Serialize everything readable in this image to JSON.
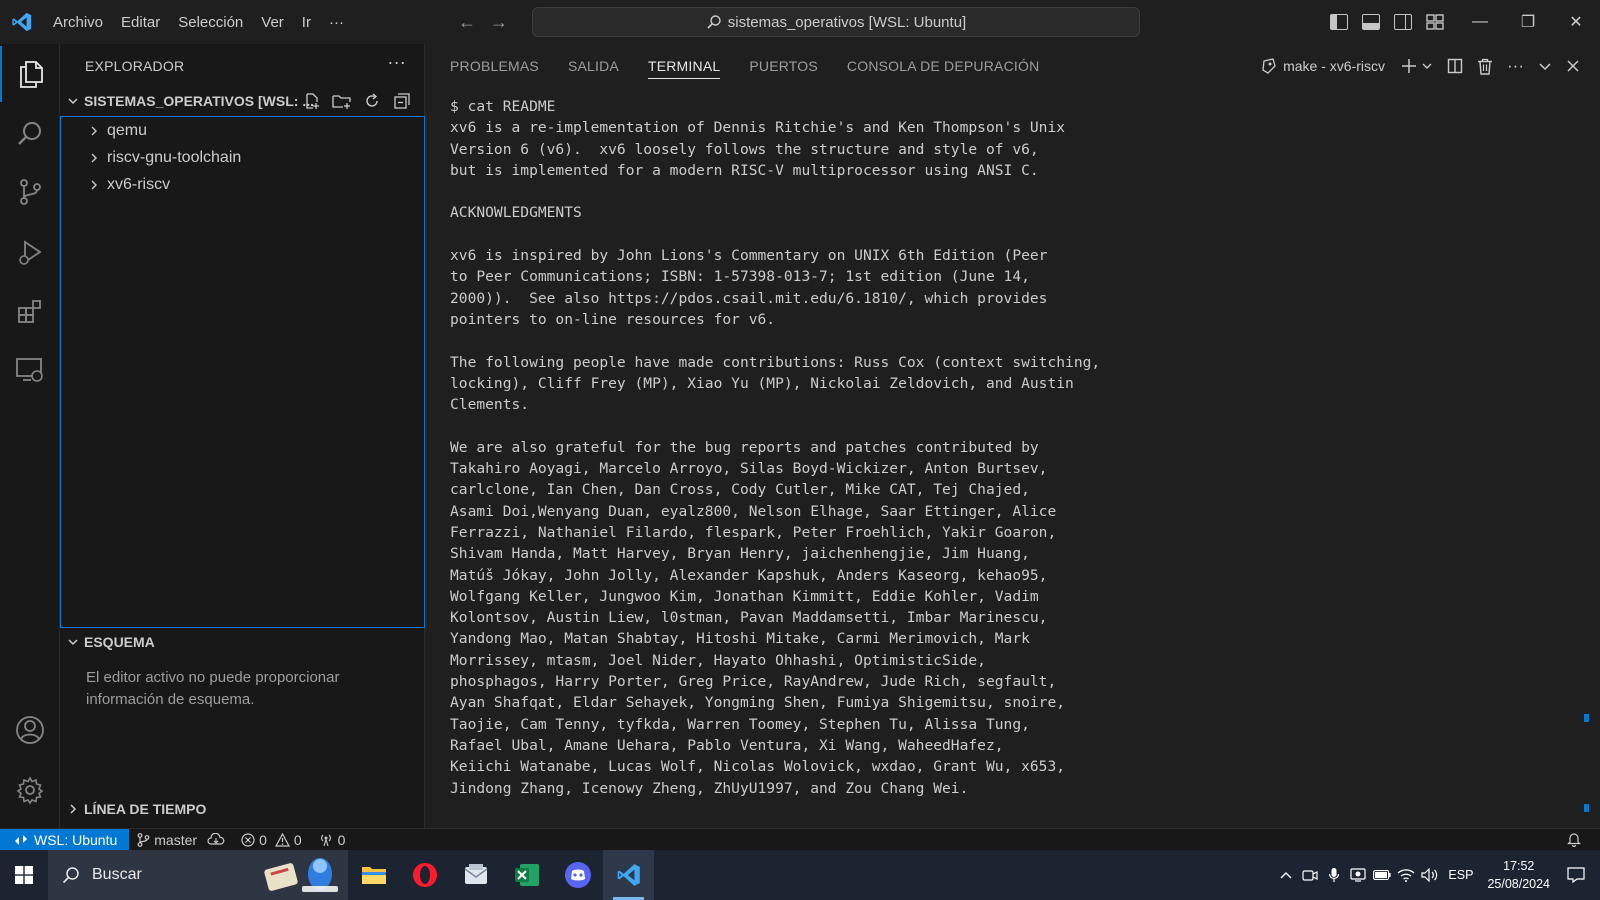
{
  "titlebar": {
    "menu": [
      "Archivo",
      "Editar",
      "Selección",
      "Ver",
      "Ir",
      "···"
    ],
    "command_center": "sistemas_operativos [WSL: Ubuntu]"
  },
  "sidebar": {
    "title": "EXPLORADOR",
    "more": "···",
    "workspace": "SISTEMAS_OPERATIVOS [WSL: ...",
    "tree": [
      {
        "label": "qemu"
      },
      {
        "label": "riscv-gnu-toolchain"
      },
      {
        "label": "xv6-riscv"
      }
    ],
    "outline": {
      "title": "ESQUEMA",
      "message": "El editor activo no puede proporcionar información de esquema."
    },
    "timeline": {
      "title": "LÍNEA DE TIEMPO"
    }
  },
  "panel": {
    "tabs": [
      "PROBLEMAS",
      "SALIDA",
      "TERMINAL",
      "PUERTOS",
      "CONSOLA DE DEPURACIÓN"
    ],
    "active_tab": "TERMINAL",
    "terminal_name": "make - xv6-riscv",
    "terminal_lines": [
      "$ cat README",
      "xv6 is a re-implementation of Dennis Ritchie's and Ken Thompson's Unix",
      "Version 6 (v6).  xv6 loosely follows the structure and style of v6,",
      "but is implemented for a modern RISC-V multiprocessor using ANSI C.",
      "",
      "ACKNOWLEDGMENTS",
      "",
      "xv6 is inspired by John Lions's Commentary on UNIX 6th Edition (Peer",
      "to Peer Communications; ISBN: 1-57398-013-7; 1st edition (June 14,",
      "2000)).  See also https://pdos.csail.mit.edu/6.1810/, which provides",
      "pointers to on-line resources for v6.",
      "",
      "The following people have made contributions: Russ Cox (context switching,",
      "locking), Cliff Frey (MP), Xiao Yu (MP), Nickolai Zeldovich, and Austin",
      "Clements.",
      "",
      "We are also grateful for the bug reports and patches contributed by",
      "Takahiro Aoyagi, Marcelo Arroyo, Silas Boyd-Wickizer, Anton Burtsev,",
      "carlclone, Ian Chen, Dan Cross, Cody Cutler, Mike CAT, Tej Chajed,",
      "Asami Doi,Wenyang Duan, eyalz800, Nelson Elhage, Saar Ettinger, Alice",
      "Ferrazzi, Nathaniel Filardo, flespark, Peter Froehlich, Yakir Goaron,",
      "Shivam Handa, Matt Harvey, Bryan Henry, jaichenhengjie, Jim Huang,",
      "Matúš Jókay, John Jolly, Alexander Kapshuk, Anders Kaseorg, kehao95,",
      "Wolfgang Keller, Jungwoo Kim, Jonathan Kimmitt, Eddie Kohler, Vadim",
      "Kolontsov, Austin Liew, l0stman, Pavan Maddamsetti, Imbar Marinescu,",
      "Yandong Mao, Matan Shabtay, Hitoshi Mitake, Carmi Merimovich, Mark",
      "Morrissey, mtasm, Joel Nider, Hayato Ohhashi, OptimisticSide,",
      "phosphagos, Harry Porter, Greg Price, RayAndrew, Jude Rich, segfault,",
      "Ayan Shafqat, Eldar Sehayek, Yongming Shen, Fumiya Shigemitsu, snoire,",
      "Taojie, Cam Tenny, tyfkda, Warren Toomey, Stephen Tu, Alissa Tung,",
      "Rafael Ubal, Amane Uehara, Pablo Ventura, Xi Wang, WaheedHafez,",
      "Keiichi Watanabe, Lucas Wolf, Nicolas Wolovick, wxdao, Grant Wu, x653,",
      "Jindong Zhang, Icenowy Zheng, ZhUyU1997, and Zou Chang Wei."
    ]
  },
  "statusbar": {
    "remote": "WSL: Ubuntu",
    "branch": "master",
    "errors": "0",
    "warnings": "0",
    "ports": "0"
  },
  "taskbar": {
    "search_placeholder": "Buscar",
    "language": "ESP",
    "time": "17:52",
    "date": "25/08/2024"
  },
  "colors": {
    "accent": "#0078d4",
    "background": "#1f1f1f",
    "sidebar": "#181818",
    "taskbar": "#1c2432"
  }
}
